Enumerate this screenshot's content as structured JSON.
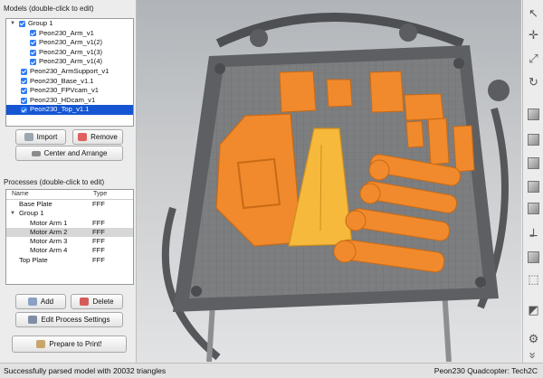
{
  "models": {
    "section_title": "Models (double-click to edit)",
    "items": [
      {
        "label": "Group 1",
        "level": 0,
        "group": true,
        "selected": false
      },
      {
        "label": "Peon230_Arm_v1",
        "level": 1,
        "selected": false
      },
      {
        "label": "Peon230_Arm_v1(2)",
        "level": 1,
        "selected": false
      },
      {
        "label": "Peon230_Arm_v1(3)",
        "level": 1,
        "selected": false
      },
      {
        "label": "Peon230_Arm_v1(4)",
        "level": 1,
        "selected": false
      },
      {
        "label": "Peon230_ArmSupport_v1",
        "level": 0,
        "selected": false
      },
      {
        "label": "Peon230_Base_v1.1",
        "level": 0,
        "selected": false
      },
      {
        "label": "Peon230_FPVcam_v1",
        "level": 0,
        "selected": false
      },
      {
        "label": "Peon230_HDcam_v1",
        "level": 0,
        "selected": false
      },
      {
        "label": "Peon230_Top_v1.1",
        "level": 0,
        "selected": true
      }
    ],
    "import_label": "Import",
    "remove_label": "Remove",
    "center_label": "Center and Arrange"
  },
  "processes": {
    "section_title": "Processes (double-click to edit)",
    "col_name": "Name",
    "col_type": "Type",
    "rows": [
      {
        "name": "Base Plate",
        "type": "FFF",
        "level": 0,
        "selected": false
      },
      {
        "name": "Group 1",
        "type": "",
        "level": 0,
        "group": true,
        "selected": false
      },
      {
        "name": "Motor Arm 1",
        "type": "FFF",
        "level": 1,
        "selected": false
      },
      {
        "name": "Motor Arm 2",
        "type": "FFF",
        "level": 1,
        "selected": true
      },
      {
        "name": "Motor Arm 3",
        "type": "FFF",
        "level": 1,
        "selected": false
      },
      {
        "name": "Motor Arm 4",
        "type": "FFF",
        "level": 1,
        "selected": false
      },
      {
        "name": "Top Plate",
        "type": "FFF",
        "level": 0,
        "selected": false
      }
    ],
    "add_label": "Add",
    "delete_label": "Delete",
    "edit_label": "Edit Process Settings",
    "prepare_label": "Prepare to Print!"
  },
  "toolbar": [
    "cursor-icon",
    "move-icon",
    "scale-icon",
    "rotate-icon",
    "view-cube-icon",
    "view-cube-icon",
    "view-cube-icon",
    "view-cube-icon",
    "view-cube-icon",
    "axes-icon",
    "view-cube-icon",
    "wireframe-cube-icon",
    "section-icon",
    "settings-gear-icon",
    "expand-icon"
  ],
  "status": {
    "message": "Successfully parsed model with 20032 triangles",
    "project": "Peon230 Quadcopter: Tech2C"
  },
  "colors": {
    "part_orange": "#f08a2c",
    "part_yellow": "#f6b93b",
    "selection_blue": "#1656d3"
  }
}
